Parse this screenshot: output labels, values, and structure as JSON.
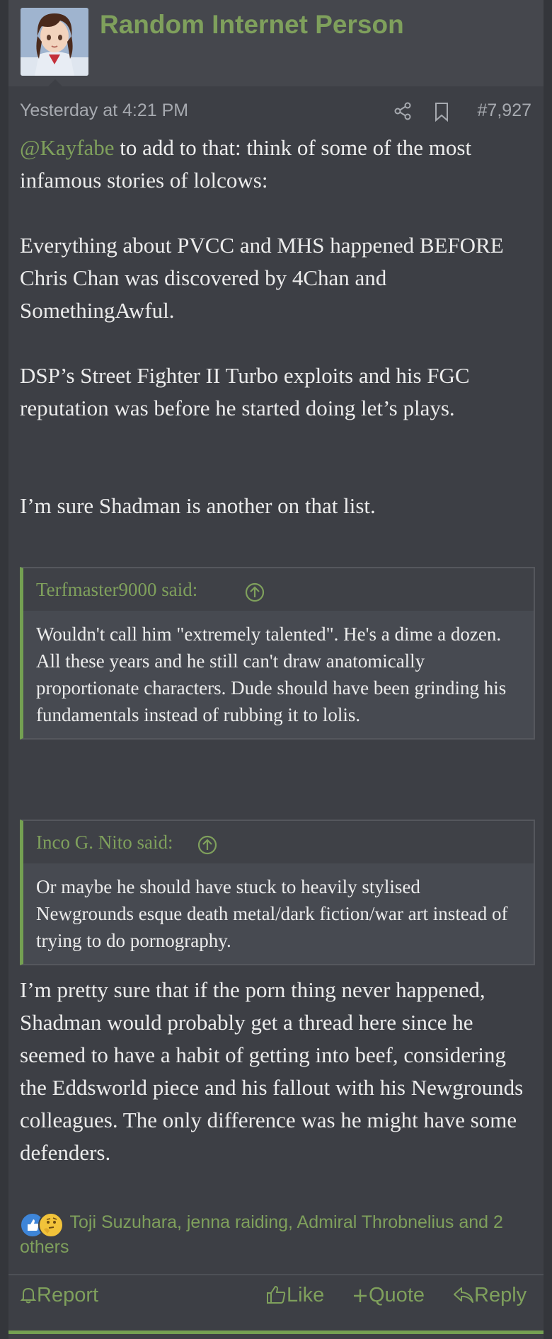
{
  "post": {
    "author": "Random Internet Person",
    "date": "Yesterday at 4:21 PM",
    "post_number": "#7,927",
    "icons": [
      "share-icon",
      "bookmark-icon"
    ],
    "intro_mention": "@Kayfabe",
    "intro_rest": " to add to that: think of some of the most infamous stories of lolcows:",
    "para1": "Everything about PVCC and MHS happened BEFORE Chris Chan was discovered by 4Chan and SomethingAwful.",
    "para2": "DSP’s Street Fighter II Turbo exploits and his FGC reputation was before he started doing let’s plays.",
    "para3": "I’m sure Shadman is another on that list.",
    "closing": "I’m pretty sure that if the porn thing never happened, Shadman would probably get a thread here since he seemed to have a habit of getting into beef, considering the Eddsworld piece and his fallout with his Newgrounds colleagues. The only difference was he might have some defenders."
  },
  "quotes": [
    {
      "author": "Terfmaster9000 said:",
      "text": "Wouldn't call him \"extremely talented\". He's a dime a dozen. All these years and he still can't draw anatomically proportionate characters. Dude should have been grinding his fundamentals instead of rubbing it to lolis."
    },
    {
      "author": "Inco G. Nito said:",
      "text": "Or maybe he should have stuck to heavily stylised Newgrounds esque death metal/dark fiction/war art instead of trying to do pornography."
    }
  ],
  "reactions": {
    "names": "Toji Suzuhara, jenna raiding, Admiral Throbnelius and 2 others",
    "icons": [
      "like-reaction-icon",
      "thinking-reaction-icon"
    ]
  },
  "footer": {
    "report": "Report",
    "like": "Like",
    "quote": "Quote",
    "reply": "Reply"
  },
  "colors": {
    "accent": "#7fa05c",
    "background": "#3d3f45",
    "quote_bar": "#74a052"
  }
}
